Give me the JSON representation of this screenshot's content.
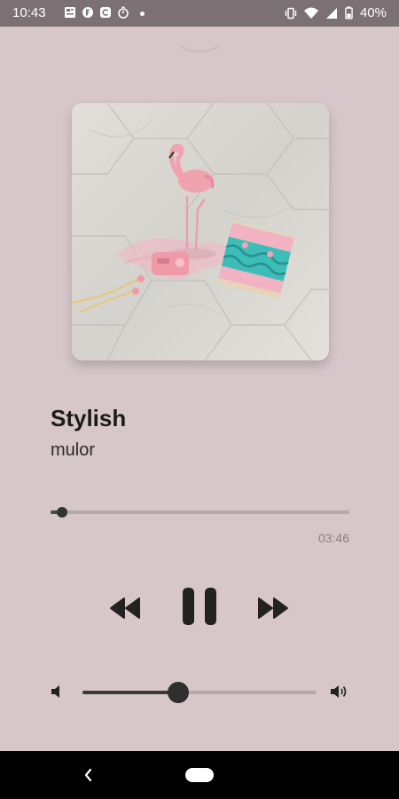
{
  "status_bar": {
    "time": "10:43",
    "battery": "40%",
    "left_icons": [
      "news-icon",
      "f-icon",
      "c-icon",
      "stopwatch-icon",
      "dot-icon"
    ],
    "right_icons": [
      "vibrate-icon",
      "wifi-icon",
      "signal-icon",
      "battery-icon"
    ]
  },
  "player": {
    "title": "Stylish",
    "artist": "mulor",
    "duration": "03:46",
    "progress_fraction": 0.04,
    "volume_fraction": 0.41,
    "album_art": "flamingo-album-art"
  },
  "controls": {
    "rewind": "rewind-icon",
    "pause": "pause-icon",
    "forward": "fast-forward-icon",
    "volume_low": "volume-low-icon",
    "volume_high": "volume-high-icon"
  },
  "colors": {
    "background": "#d7c7ca",
    "status_bar": "#7b7174",
    "accent": "#333333"
  }
}
